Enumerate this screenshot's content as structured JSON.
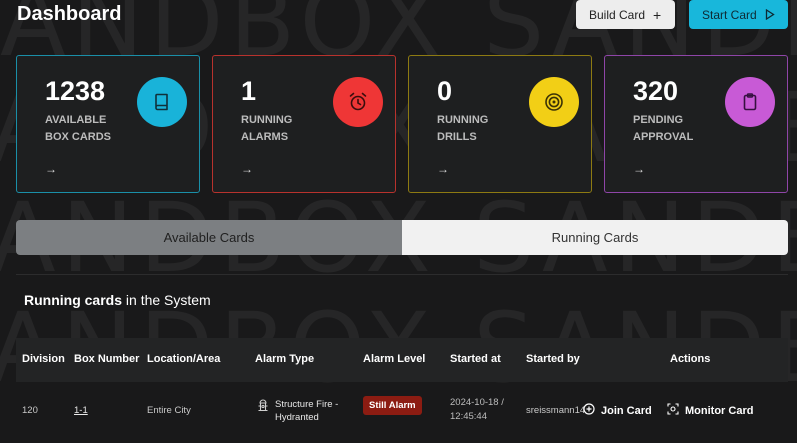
{
  "header": {
    "title": "Dashboard",
    "build_card_label": "Build Card",
    "start_card_label": "Start Card"
  },
  "watermark_text": "SANDBOX",
  "stat_cards": [
    {
      "value": "1238",
      "label_line1": "AVAILABLE",
      "label_line2": "BOX CARDS",
      "icon": "book-icon",
      "color": "#19b3d9",
      "border": "#1a8fa8"
    },
    {
      "value": "1",
      "label_line1": "RUNNING",
      "label_line2": "ALARMS",
      "icon": "alarm-clock-icon",
      "color": "#ef3636",
      "border": "#b8322d"
    },
    {
      "value": "0",
      "label_line1": "RUNNING",
      "label_line2": "DRILLS",
      "icon": "target-icon",
      "color": "#f2cf16",
      "border": "#8d7a12"
    },
    {
      "value": "320",
      "label_line1": "PENDING",
      "label_line2": "APPROVAL",
      "icon": "clipboard-icon",
      "color": "#c85ad6",
      "border": "#8f45a8"
    }
  ],
  "tabs": {
    "available": "Available Cards",
    "running": "Running Cards",
    "active": "running"
  },
  "section": {
    "title_bold": "Running cards",
    "title_rest": " in the System"
  },
  "table": {
    "columns": [
      "Division",
      "Box Number",
      "Location/Area",
      "Alarm Type",
      "Alarm Level",
      "Started at",
      "Started by",
      "Actions"
    ],
    "rows": [
      {
        "division": "120",
        "box_number": "1-1",
        "location": "Entire City",
        "alarm_type_line1": "Structure Fire -",
        "alarm_type_line2": "Hydranted",
        "alarm_level": "Still Alarm",
        "started_date": "2024-10-18 /",
        "started_time": "12:45:44",
        "started_by": "sreissmann14",
        "join_label": "Join Card",
        "monitor_label": "Monitor Card"
      }
    ]
  }
}
